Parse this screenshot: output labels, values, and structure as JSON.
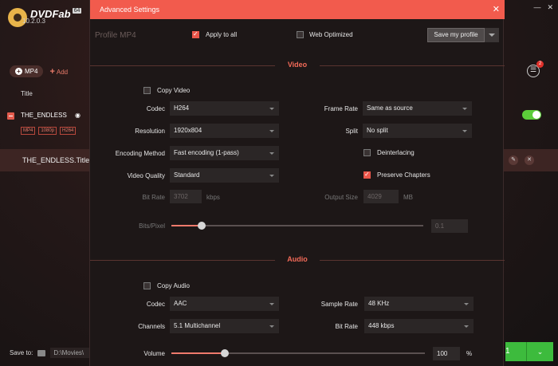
{
  "app": {
    "logo": "DVDFab",
    "logo_badge": "64",
    "version": "10.2.0.3",
    "mp4_button": "MP4",
    "add_button": "Add",
    "title_header": "Title",
    "row1_title": "THE_ENDLESS",
    "tags": [
      "MP4",
      "1080p",
      "H264"
    ],
    "row2_title": "THE_ENDLESS.Title1",
    "notification_count": "2",
    "save_to_label": "Save to:",
    "save_path": "D:\\Movies\\",
    "start_count": "1"
  },
  "modal": {
    "title": "Advanced Settings",
    "profile_label": "Profile  MP4",
    "apply_to_all": "Apply to all",
    "apply_to_all_checked": true,
    "web_optimized": "Web Optimized",
    "web_optimized_checked": false,
    "save_profile": "Save my profile",
    "video": {
      "section": "Video",
      "copy_video": "Copy Video",
      "copy_video_checked": false,
      "codec_label": "Codec",
      "codec": "H264",
      "resolution_label": "Resolution",
      "resolution": "1920x804",
      "encoding_label": "Encoding Method",
      "encoding": "Fast encoding (1-pass)",
      "quality_label": "Video Quality",
      "quality": "Standard",
      "bitrate_label": "Bit Rate",
      "bitrate": "3702",
      "bitrate_unit": "kbps",
      "framerate_label": "Frame Rate",
      "framerate": "Same as source",
      "split_label": "Split",
      "split": "No split",
      "deinterlacing": "Deinterlacing",
      "deinterlacing_checked": false,
      "preserve_chapters": "Preserve Chapters",
      "preserve_chapters_checked": true,
      "output_size_label": "Output Size",
      "output_size": "4029",
      "output_size_unit": "MB",
      "bits_pixel_label": "Bits/Pixel",
      "bits_pixel": "0.1",
      "bits_pixel_level": 0.12
    },
    "audio": {
      "section": "Audio",
      "copy_audio": "Copy Audio",
      "copy_audio_checked": false,
      "codec_label": "Codec",
      "codec": "AAC",
      "channels_label": "Channels",
      "channels": "5.1 Multichannel",
      "samplerate_label": "Sample Rate",
      "samplerate": "48 KHz",
      "bitrate_label": "Bit Rate",
      "bitrate": "448 kbps",
      "volume_label": "Volume",
      "volume": "100",
      "volume_unit": "%",
      "volume_level": 0.21
    }
  }
}
